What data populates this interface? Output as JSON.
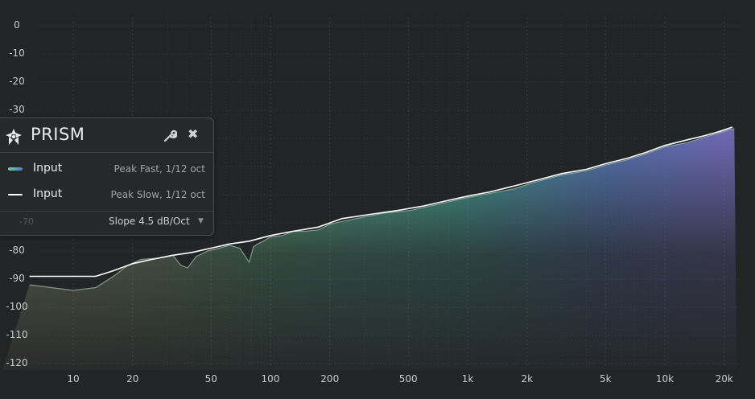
{
  "plugin": {
    "title": "PRISM"
  },
  "legend": {
    "rows": [
      {
        "label": "Input",
        "mode": "Peak Fast, 1/12 oct",
        "swatch": "gradient-green-blue"
      },
      {
        "label": "Input",
        "mode": "Peak Slow, 1/12 oct",
        "swatch": "white-line"
      }
    ],
    "slope": "Slope 4.5 dB/Oct",
    "hidden_tick": "-70"
  },
  "icons": [
    "prism-logo-icon",
    "wrench-icon",
    "close-icon",
    "chevron-down-icon"
  ],
  "colors": {
    "background": "#232426",
    "grid": "#3a3c40",
    "fill_low": "#e4e7b0",
    "fill_mid": "#5fc99a",
    "fill_high": "#7a6fc4",
    "line": "#ffffff"
  },
  "chart_data": {
    "type": "area",
    "x_scale": "log",
    "xlim": [
      6,
      25000
    ],
    "ylim": [
      -120,
      0
    ],
    "grid": true,
    "y_ticks": [
      0,
      -10,
      -20,
      -30,
      -80,
      -90,
      -100,
      -110,
      -120
    ],
    "y_tick_labels": [
      "0",
      "-10",
      "-20",
      "-30",
      "-80",
      "-90",
      "-100",
      "-110",
      "-120"
    ],
    "x_ticks": [
      10,
      20,
      50,
      100,
      200,
      500,
      1000,
      2000,
      5000,
      10000,
      20000
    ],
    "x_tick_labels": [
      "10",
      "20",
      "50",
      "100",
      "200",
      "500",
      "1k",
      "2k",
      "5k",
      "10k",
      "20k"
    ],
    "series": [
      {
        "name": "Input",
        "mode": "Peak Fast, 1/12 oct",
        "x": [
          6,
          10,
          13,
          16,
          19,
          22,
          27,
          32,
          35,
          38,
          42,
          48,
          55,
          62,
          70,
          78,
          82,
          86,
          92,
          100,
          115,
          130,
          150,
          175,
          200,
          230,
          270,
          320,
          380,
          450,
          520,
          600,
          700,
          800,
          1000,
          1300,
          1700,
          2200,
          3000,
          4000,
          5000,
          6500,
          8000,
          10000,
          13000,
          16000,
          19000,
          21000,
          22500
        ],
        "y": [
          -92,
          -94,
          -93,
          -89,
          -85,
          -83,
          -82.5,
          -81.5,
          -85,
          -86,
          -82,
          -80,
          -79,
          -78,
          -79,
          -84,
          -78.5,
          -77.5,
          -76.5,
          -75,
          -74.5,
          -73,
          -73,
          -72.5,
          -70.5,
          -69.5,
          -68.5,
          -67.5,
          -66.5,
          -66,
          -65.5,
          -64.5,
          -63.5,
          -62.5,
          -61,
          -59.5,
          -58,
          -55.5,
          -53,
          -51.5,
          -49.5,
          -47.5,
          -45.5,
          -43,
          -41.5,
          -39.5,
          -38,
          -37,
          -36.5
        ]
      },
      {
        "name": "Input",
        "mode": "Peak Slow, 1/12 oct",
        "x": [
          6,
          13,
          16,
          20,
          25,
          32,
          40,
          50,
          62,
          78,
          100,
          130,
          175,
          230,
          320,
          450,
          600,
          800,
          1000,
          1300,
          1700,
          2200,
          3000,
          4000,
          5000,
          6500,
          8000,
          10000,
          13000,
          16000,
          19000,
          22000
        ],
        "y": [
          -89,
          -89,
          -87,
          -84.5,
          -83,
          -81.5,
          -80.5,
          -79,
          -77.5,
          -76.5,
          -74.5,
          -73,
          -71.5,
          -68.5,
          -67,
          -65.5,
          -64,
          -62,
          -60.5,
          -59,
          -57,
          -55,
          -52.5,
          -51,
          -49,
          -47,
          -45,
          -42.5,
          -40.5,
          -39,
          -37.5,
          -36
        ]
      }
    ]
  }
}
